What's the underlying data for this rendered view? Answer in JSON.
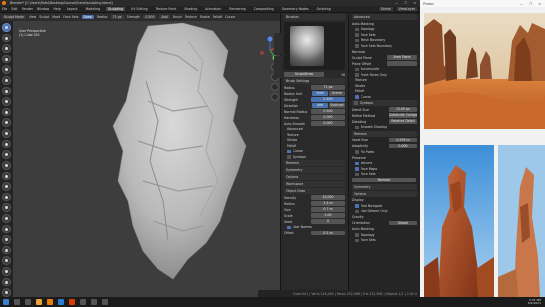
{
  "window": {
    "title": "Blender* [C:\\Users\\Rafal\\Desktop\\Course\\Scene\\sculpting.blend]",
    "controls": [
      "—",
      "☐",
      "✕"
    ]
  },
  "menu": {
    "items": [
      "File",
      "Edit",
      "Render",
      "Window",
      "Help"
    ],
    "workspaces": [
      "Layout",
      "Modeling",
      "Sculpting",
      "UV Editing",
      "Texture Paint",
      "Shading",
      "Animation",
      "Rendering",
      "Compositing",
      "Geometry Nodes",
      "Scripting"
    ],
    "active_workspace": "Sculpting",
    "scene": "Scene",
    "view_layer": "ViewLayer"
  },
  "tool_header": {
    "mode": "Sculpt Mode",
    "menus": [
      "View",
      "Sculpt",
      "Mask",
      "Face Sets"
    ],
    "brush": "Draw",
    "radius_label": "Radius",
    "radius": "71 px",
    "strength_label": "Strength",
    "strength": "0.500",
    "direction": "Add",
    "brush_menu": "Brush",
    "texture_menu": "Texture",
    "stroke_menu": "Stroke",
    "falloff_menu": "Falloff",
    "cursor_menu": "Cursor"
  },
  "viewport": {
    "view_name": "User Perspective",
    "object": "(1) Cube.001"
  },
  "brush_panel": {
    "tabs": [
      "Brushes"
    ],
    "brush_name": "SculptDraw",
    "brush_users": "16",
    "section_brush_settings": "Brush Settings",
    "radius_label": "Radius",
    "radius_value": "71 px",
    "radius_unit_label": "Radius Unit",
    "radius_unit_view": "View",
    "radius_unit_scene": "Scene",
    "strength_label": "Strength",
    "strength_value": "0.500",
    "direction_label": "Direction",
    "direction_add": "Add",
    "direction_sub": "Subtract",
    "normal_radius_label": "Normal Radius",
    "normal_radius_value": "0.500",
    "hardness_label": "Hardness",
    "hardness_value": "0.000",
    "auto_smooth_label": "Auto-Smooth",
    "auto_smooth_value": "0.000",
    "subsections": [
      "Advanced",
      "Texture",
      "Stroke",
      "Falloff",
      "Cursor"
    ],
    "dyntopo": "Dyntopo",
    "remesh": "Remesh",
    "symmetry": "Symmetry",
    "options": "Options",
    "workspace": "Workspace",
    "object_data": "Object Data",
    "density_label": "Density",
    "density_value": "10,000",
    "radius2_label": "Radius",
    "radius2_value": "1.4 m",
    "size_label": "Size",
    "size_value": "0.7 m",
    "scale_label": "Scale",
    "scale_value": "2.00",
    "seed_label": "Seed",
    "seed_value": "0",
    "user_names": "User Names",
    "offset_label": "Offset",
    "offset_value": "0.1 m"
  },
  "props_panel": {
    "sections": [
      "Advanced",
      "Texture",
      "Stroke",
      "Falloff",
      "Cursor",
      "Dyntopo",
      "Remesh",
      "Symmetry",
      "Options"
    ],
    "auto_masking_label": "Auto-Masking",
    "auto_masking_opts": [
      "Topology",
      "Face Sets",
      "Mesh Boundary",
      "Face Sets Boundary"
    ],
    "normals": "Normals",
    "sculpt_plane_label": "Sculpt Plane",
    "sculpt_plane_value": "Area Plane",
    "plane_offset_label": "Plane Offset",
    "normals_opts": [
      "Accumulate",
      "Front Faces Only"
    ],
    "texture_label": "Texture",
    "stroke_label": "Stroke",
    "falloff_label": "Falloff",
    "cursor_label": "Cursor",
    "detail_size_label": "Detail Size",
    "detail_size_value": "12.00 px",
    "refine_label": "Refine Method",
    "refine_value": "Subdivide Collapse",
    "detailing_label": "Detailing",
    "detailing_value": "Relative Detail",
    "smooth_shading": "Smooth Shading",
    "voxel_size_label": "Voxel Size",
    "voxel_size_value": "0.295 m",
    "adaptivity_label": "Adaptivity",
    "adaptivity_value": "0.000",
    "fix_poles": "Fix Poles",
    "preserve_label": "Preserve",
    "preserve_opts": [
      "Volume",
      "Face Maps",
      "Face Sets"
    ],
    "remesh_button": "Remesh",
    "display_label": "Display",
    "display_opts": [
      "Fast Navigate",
      "Use Deform Only",
      "Use Deform Only"
    ],
    "gravity_label": "Gravity",
    "orientation_label": "Orientation",
    "orientation_value": "Global",
    "options_rows": [
      "Auto-Masking",
      "Topology",
      "Face Sets"
    ]
  },
  "photos_app": {
    "title": "Photos",
    "controls": [
      "—",
      "☐",
      "✕"
    ]
  },
  "status_bar": {
    "text": "Cube.001 | Verts 116,454 | Faces 232,908 | Tris 232,908 | Objects 1/1 | 2.92.0"
  },
  "taskbar": {
    "time": "3:31 PM",
    "date": "3/9/2021"
  }
}
